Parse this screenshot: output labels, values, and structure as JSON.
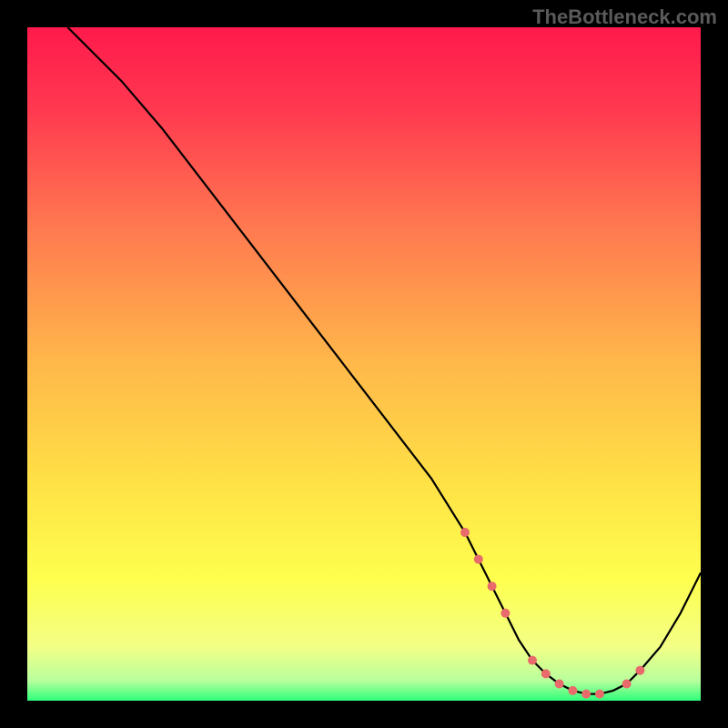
{
  "watermark": "TheBottleneck.com",
  "chart_data": {
    "type": "line",
    "title": "",
    "xlabel": "",
    "ylabel": "",
    "xlim": [
      0,
      100
    ],
    "ylim": [
      0,
      100
    ],
    "grid": false,
    "series": [
      {
        "name": "bottleneck-curve",
        "x": [
          6,
          8,
          10,
          14,
          20,
          30,
          40,
          50,
          60,
          65,
          67,
          69,
          71,
          73,
          75,
          77,
          79,
          81,
          83,
          85,
          87,
          89,
          91,
          94,
          97,
          100
        ],
        "y": [
          100,
          98,
          96,
          92,
          85,
          72,
          59,
          46,
          33,
          25,
          21,
          17,
          13,
          9,
          6,
          4,
          2.5,
          1.5,
          1,
          1,
          1.5,
          2.5,
          4.5,
          8,
          13,
          19
        ]
      }
    ],
    "highlight_points": {
      "name": "optimal-zone",
      "x": [
        65,
        67,
        69,
        71,
        75,
        77,
        79,
        81,
        83,
        85,
        89,
        91
      ],
      "y": [
        25,
        21,
        17,
        13,
        6,
        4,
        2.5,
        1.5,
        1,
        1,
        2.5,
        4.5
      ]
    },
    "gradient_stops": [
      {
        "offset": 0.0,
        "color": "#ff1a4c"
      },
      {
        "offset": 0.12,
        "color": "#ff3850"
      },
      {
        "offset": 0.3,
        "color": "#ff7a50"
      },
      {
        "offset": 0.5,
        "color": "#ffb84a"
      },
      {
        "offset": 0.68,
        "color": "#ffe246"
      },
      {
        "offset": 0.82,
        "color": "#feff4e"
      },
      {
        "offset": 0.92,
        "color": "#f3ff86"
      },
      {
        "offset": 0.97,
        "color": "#b8ff9c"
      },
      {
        "offset": 1.0,
        "color": "#2eff7a"
      }
    ],
    "highlight_color": "#e86a6a",
    "line_color": "#000000"
  }
}
